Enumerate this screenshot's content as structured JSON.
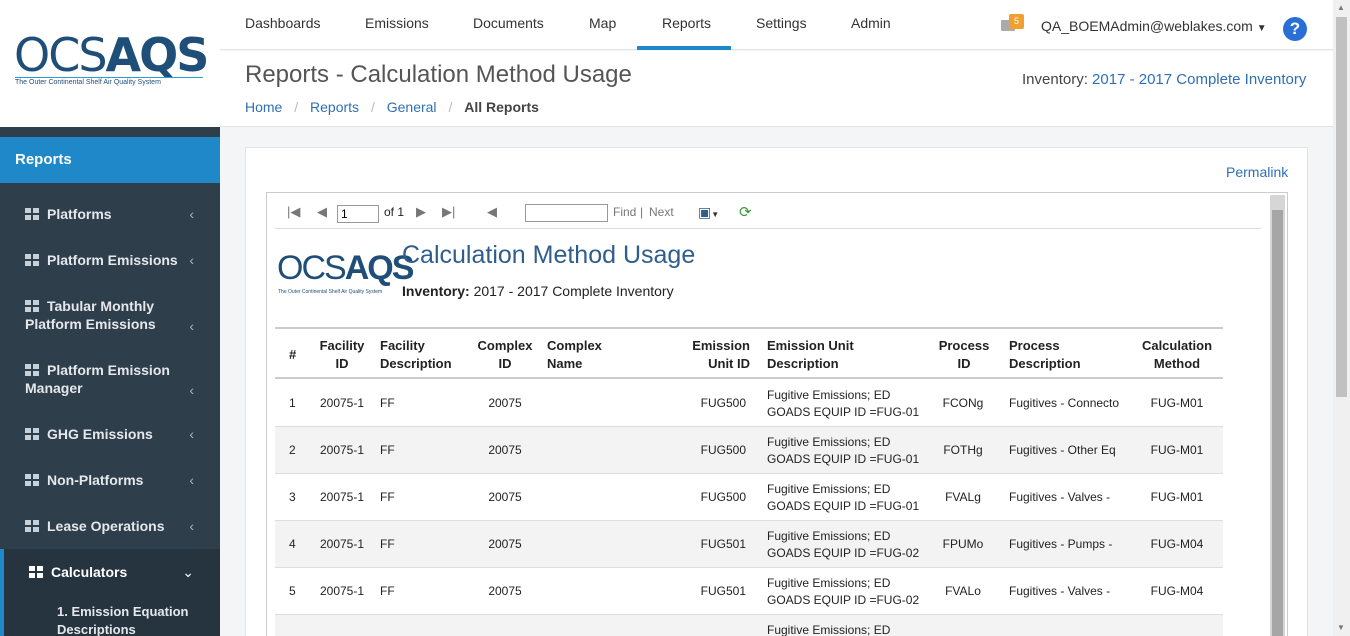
{
  "logo": {
    "part1": "OCS",
    "part2": "AQS",
    "tagline": "The Outer Continental Shelf Air Quality System"
  },
  "nav": {
    "tabs": [
      "Dashboards",
      "Emissions",
      "Documents",
      "Map",
      "Reports",
      "Settings",
      "Admin"
    ],
    "mail_badge": "5",
    "user": "QA_BOEMAdmin@weblakes.com",
    "help": "?"
  },
  "sidebar": {
    "header": "Reports",
    "items": [
      {
        "label": "Platforms",
        "chevron": "‹"
      },
      {
        "label": "Platform Emissions",
        "chevron": "‹"
      },
      {
        "label": "Tabular Monthly Platform Emissions",
        "chevron": "‹"
      },
      {
        "label": "Platform Emission Manager",
        "chevron": "‹"
      },
      {
        "label": "GHG Emissions",
        "chevron": "‹"
      },
      {
        "label": "Non-Platforms",
        "chevron": "‹"
      },
      {
        "label": "Lease Operations",
        "chevron": "‹"
      },
      {
        "label": "Calculators",
        "chevron": "⌄"
      }
    ],
    "subitem": "1. Emission Equation Descriptions"
  },
  "header": {
    "title": "Reports - Calculation Method Usage",
    "breadcrumbs": [
      "Home",
      "Reports",
      "General",
      "All Reports"
    ],
    "inventory_label": "Inventory:",
    "inventory_value": "2017 - 2017 Complete Inventory"
  },
  "panel": {
    "permalink": "Permalink"
  },
  "toolbar": {
    "page": "1",
    "of": "of 1",
    "find": "Find",
    "sep": "|",
    "next": "Next"
  },
  "report": {
    "title": "Calculation Method Usage",
    "inventory_label": "Inventory:",
    "inventory_value": "2017 -  2017 Complete Inventory",
    "headers": [
      "#",
      "Facility ID",
      "Facility Description",
      "Complex ID",
      "Complex Name",
      "Emission Unit ID",
      "Emission Unit Description",
      "Process ID",
      "Process Description",
      "Calculation Method"
    ],
    "rows": [
      [
        "1",
        "20075-1",
        "FF",
        "20075",
        "",
        "FUG500",
        "Fugitive Emissions; ED GOADS EQUIP ID =FUG-01",
        "FCONg",
        "Fugitives - Connecto",
        "FUG-M01"
      ],
      [
        "2",
        "20075-1",
        "FF",
        "20075",
        "",
        "FUG500",
        "Fugitive Emissions; ED GOADS EQUIP ID =FUG-01",
        "FOTHg",
        "Fugitives - Other Eq",
        "FUG-M01"
      ],
      [
        "3",
        "20075-1",
        "FF",
        "20075",
        "",
        "FUG500",
        "Fugitive Emissions; ED GOADS EQUIP ID =FUG-01",
        "FVALg",
        "Fugitives - Valves -",
        "FUG-M01"
      ],
      [
        "4",
        "20075-1",
        "FF",
        "20075",
        "",
        "FUG501",
        "Fugitive Emissions; ED GOADS EQUIP ID =FUG-02",
        "FPUMo",
        "Fugitives - Pumps -",
        "FUG-M04"
      ],
      [
        "5",
        "20075-1",
        "FF",
        "20075",
        "",
        "FUG501",
        "Fugitive Emissions; ED GOADS EQUIP ID =FUG-02",
        "FVALo",
        "Fugitives - Valves -",
        "FUG-M04"
      ],
      [
        "",
        "",
        "",
        "",
        "",
        "",
        "Fugitive Emissions; ED GOADS",
        "",
        "",
        ""
      ]
    ]
  }
}
